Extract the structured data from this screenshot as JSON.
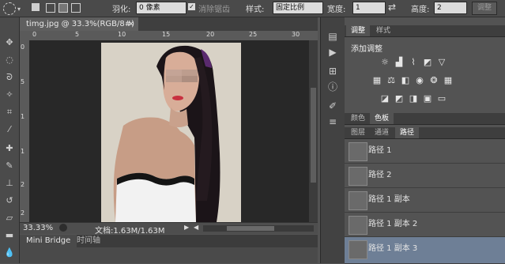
{
  "options_bar": {
    "feather_label": "羽化:",
    "feather_value": "0 像素",
    "antialias_label": "消除锯齿",
    "style_label": "样式:",
    "style_value": "固定比例",
    "width_label": "宽度:",
    "width_value": "1",
    "height_label": "高度:",
    "height_value": "2",
    "adjust_edge_label": "调整"
  },
  "document": {
    "tab_title": "timg.jpg @ 33.3%(RGB/8#) *",
    "close_symbol": "×",
    "ruler_top_ticks": [
      "0",
      "5",
      "10",
      "15",
      "20",
      "25",
      "30"
    ],
    "ruler_left_ticks": [
      "0",
      "5",
      "1",
      "1",
      "2",
      "2"
    ]
  },
  "status_bar": {
    "zoom": "33.33%",
    "doc_info": "文档:1.63M/1.63M"
  },
  "bottom_tabs": [
    {
      "label": "Mini Bridge"
    },
    {
      "label": "时间轴"
    }
  ],
  "adjustments_panel": {
    "tabs": [
      {
        "label": "调整"
      },
      {
        "label": "样式"
      }
    ],
    "title": "添加调整",
    "icons_row1": [
      "brightness-icon",
      "levels-icon",
      "curves-icon",
      "exposure-icon",
      "vibrance-icon"
    ],
    "icons_row2": [
      "hue-saturation-icon",
      "color-balance-icon",
      "black-white-icon",
      "photo-filter-icon",
      "channel-mixer-icon",
      "color-lookup-icon"
    ],
    "icons_row3": [
      "invert-icon",
      "posterize-icon",
      "threshold-icon",
      "selective-color-icon",
      "gradient-map-icon"
    ]
  },
  "color_panel": {
    "tabs": [
      {
        "label": "颜色"
      },
      {
        "label": "色板"
      }
    ]
  },
  "paths_panel": {
    "tabs": [
      {
        "label": "图层"
      },
      {
        "label": "通道"
      },
      {
        "label": "路径"
      }
    ],
    "paths": [
      {
        "label": "路径 1"
      },
      {
        "label": "路径 2"
      },
      {
        "label": "路径 1 副本"
      },
      {
        "label": "路径 1 副本 2"
      },
      {
        "label": "路径 1 副本 3"
      }
    ]
  },
  "colors": {
    "selected_path_bg": "#6e7f96",
    "panel_bg": "#535353",
    "canvas_bg": "#282828"
  }
}
